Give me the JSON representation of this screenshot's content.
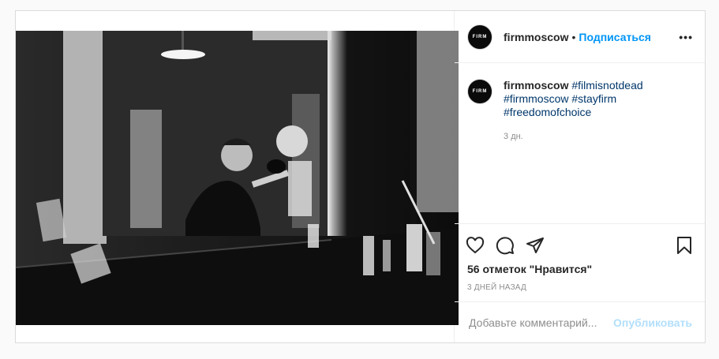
{
  "post": {
    "account": {
      "username": "firmmoscow",
      "avatar_text": "FIRM",
      "separator": "•",
      "follow_label": "Подписаться",
      "more_label": "•••"
    },
    "caption": {
      "username": "firmmoscow",
      "hashtags": [
        "#filmisnotdead",
        "#firmmoscow",
        "#stayfirm",
        "#freedomofchoice"
      ],
      "time": "3 дн."
    },
    "actions": {
      "icons": [
        "heart-icon",
        "comment-icon",
        "share-icon",
        "bookmark-icon"
      ]
    },
    "likes_text": "56 отметок \"Нравится\"",
    "date_text": "3 ДНЕЙ НАЗАД",
    "comment_box": {
      "placeholder": "Добавьте комментарий...",
      "value": "",
      "publish_label": "Опубликовать"
    },
    "colors": {
      "link_blue": "#0095f6",
      "hashtag": "#00376b",
      "publish_disabled": "#b2dffc",
      "secondary_text": "#8e8e8e"
    }
  }
}
